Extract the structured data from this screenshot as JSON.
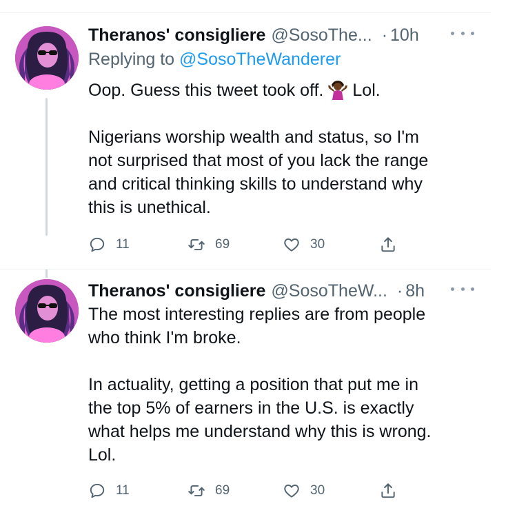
{
  "tweets": [
    {
      "display_name": "Theranos' consigliere",
      "handle": "@SosoThe...",
      "separator": "·",
      "time": "10h",
      "replying_prefix": "Replying to ",
      "replying_handle": "@SosoTheWanderer",
      "text_before_emoji": "Oop. Guess this tweet took off.",
      "emoji": "woman-shrugging-emoji",
      "text_after_emoji": "Lol.",
      "body": "Nigerians worship wealth and status, so I'm\nnot surprised that most of you lack the range\nand critical thinking skills to understand why\nthis is unethical.",
      "replies": "11",
      "retweets": "69",
      "likes": "30"
    },
    {
      "display_name": "Theranos' consigliere",
      "handle": "@SosoTheW...",
      "separator": "·",
      "time": "8h",
      "body": "The most interesting replies are from people\nwho think I'm broke.\n\nIn actuality, getting a position that put me in\nthe top 5% of earners in the U.S. is exactly\nwhat helps me understand why this is wrong.\nLol.",
      "replies": "11",
      "retweets": "69",
      "likes": "30"
    }
  ],
  "icons": {
    "reply": "reply-icon",
    "retweet": "retweet-icon",
    "like": "heart-icon",
    "share": "share-icon",
    "more": "more-dots-icon"
  },
  "colors": {
    "text": "#0f1419",
    "secondary": "#536471",
    "accent": "#1d9bf0",
    "divider": "#eff3f4",
    "thread_line": "#cfd9de"
  }
}
